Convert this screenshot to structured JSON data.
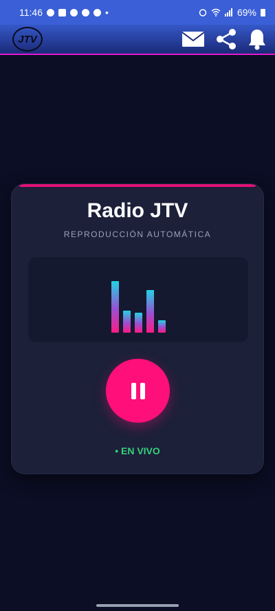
{
  "status_bar": {
    "time": "11:46",
    "dot": "•",
    "battery": "69%",
    "notification_icons": [
      "facebook-icon",
      "chat-icon",
      "app-icon",
      "app-icon",
      "app-icon"
    ]
  },
  "app_bar": {
    "logo_text": "JTV",
    "actions": [
      "mail-icon",
      "share-icon",
      "bell-icon"
    ]
  },
  "player": {
    "title": "Radio JTV",
    "subtitle": "REPRODUCCIÓN AUTOMÁTICA",
    "visualizer_levels": [
      0.75,
      0.32,
      0.29,
      0.62,
      0.18
    ],
    "state": "playing",
    "control_icon": "pause-icon",
    "live_label": "• EN VIVO"
  },
  "colors": {
    "background": "#0b0e24",
    "card": "#1c2039",
    "accent": "#ff0f7a",
    "live": "#36d17a",
    "appbar_border": "#e41ad1"
  }
}
